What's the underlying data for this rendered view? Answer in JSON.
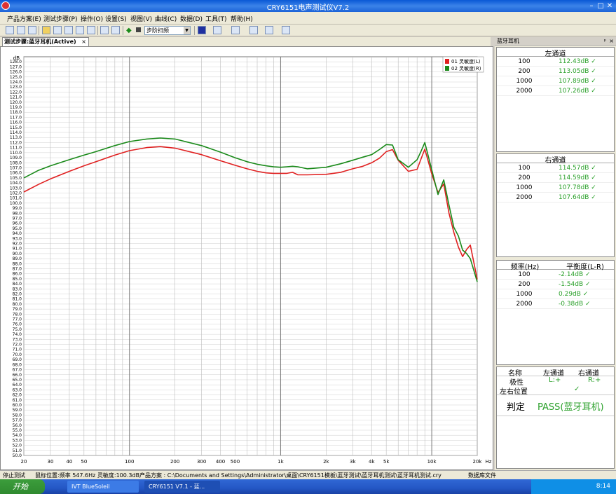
{
  "window": {
    "title": "CRY6151电声测试仪V7.2"
  },
  "menu": [
    "产品方案(E)",
    "测试步骤(P)",
    "操作(O)",
    "设置(S)",
    "视图(V)",
    "曲线(C)",
    "数据(D)",
    "工具(T)",
    "帮助(H)"
  ],
  "toolbar": {
    "sweep_mode": "步阶扫频"
  },
  "tab": {
    "label": "测试步骤:蓝牙耳机(Active)",
    "close": "×"
  },
  "panel": {
    "title": "蓝牙耳机",
    "pin": "ᵖ",
    "close": "×"
  },
  "left_channel": {
    "header": "左通道",
    "rows": [
      {
        "freq": "100",
        "value": "112.43dB ✓"
      },
      {
        "freq": "200",
        "value": "113.05dB ✓"
      },
      {
        "freq": "1000",
        "value": "107.89dB ✓"
      },
      {
        "freq": "2000",
        "value": "107.26dB ✓"
      }
    ]
  },
  "right_channel": {
    "header": "右通道",
    "rows": [
      {
        "freq": "100",
        "value": "114.57dB ✓"
      },
      {
        "freq": "200",
        "value": "114.59dB ✓"
      },
      {
        "freq": "1000",
        "value": "107.78dB ✓"
      },
      {
        "freq": "2000",
        "value": "107.64dB ✓"
      }
    ]
  },
  "balance": {
    "col1": "频率(Hz)",
    "col2": "平衡度(L-R)",
    "rows": [
      {
        "freq": "100",
        "value": "-2.14dB ✓"
      },
      {
        "freq": "200",
        "value": "-1.54dB ✓"
      },
      {
        "freq": "1000",
        "value": "0.29dB ✓"
      },
      {
        "freq": "2000",
        "value": "-0.38dB ✓"
      }
    ]
  },
  "summary": {
    "h_name": "名称",
    "h_left": "左通道",
    "h_right": "右通道",
    "polarity_label": "极性",
    "polarity_left": "L:+",
    "polarity_right": "R:+",
    "position_label": "左右位置",
    "position_value": "✓",
    "verdict_label": "判定",
    "verdict_value": "PASS(蓝牙耳机)"
  },
  "status": {
    "state": "停止测试",
    "cursor": "鼠标位置:频率 547.6Hz 灵敏度:100.3dB",
    "scheme": "产品方案 : C:\\Documents and Settings\\Administrator\\桌面\\CRY6151模板\\蓝牙测试\\蓝牙耳机测试\\蓝牙耳机测试.cry",
    "db": "数据库文件"
  },
  "taskbar": {
    "start": "开始",
    "tasks": [
      "IVT BlueSoleil",
      "CRY6151 V7.1 - 蓝..."
    ],
    "clock": "8:14"
  },
  "colors": {
    "left": "#e02020",
    "right": "#1a8a1a",
    "pass": "#2aa02a"
  },
  "chart_data": {
    "type": "line",
    "xscale": "log",
    "xlim": [
      20,
      20000
    ],
    "ylim": [
      50,
      129
    ],
    "ylabel": "dB",
    "xlabel": "Hz",
    "grid": true,
    "legend_position": "top-right",
    "x_ticks": [
      "20",
      "30",
      "40",
      "50",
      "100",
      "200",
      "300",
      "400",
      "500",
      "1k",
      "2k",
      "3k",
      "4k",
      "5k",
      "10k",
      "20k"
    ],
    "x_tick_values": [
      20,
      30,
      40,
      50,
      100,
      200,
      300,
      400,
      500,
      1000,
      2000,
      3000,
      4000,
      5000,
      10000,
      20000
    ],
    "y_ticks": [
      "50.0",
      "51.0",
      "52.0",
      "53.0",
      "54.0",
      "55.0",
      "56.0",
      "57.0",
      "58.0",
      "59.0",
      "60.0",
      "61.0",
      "62.0",
      "63.0",
      "64.0",
      "65.0",
      "66.0",
      "67.0",
      "68.0",
      "69.0",
      "70.0",
      "71.0",
      "72.0",
      "73.0",
      "74.0",
      "75.0",
      "76.0",
      "77.0",
      "78.0",
      "79.0",
      "80.0",
      "81.0",
      "82.0",
      "83.0",
      "84.0",
      "85.0",
      "86.0",
      "87.0",
      "88.0",
      "89.0",
      "90.0",
      "91.0",
      "92.0",
      "93.0",
      "94.0",
      "95.0",
      "96.0",
      "97.0",
      "98.0",
      "99.0",
      "100.0",
      "101.0",
      "102.0",
      "103.0",
      "104.0",
      "105.0",
      "106.0",
      "107.0",
      "108.0",
      "109.0",
      "110.0",
      "111.0",
      "112.0",
      "113.0",
      "114.0",
      "115.0",
      "116.0",
      "117.0",
      "118.0",
      "119.0",
      "120.0",
      "121.0",
      "122.0",
      "123.0",
      "124.0",
      "125.0",
      "126.0",
      "127.0",
      "128.0"
    ],
    "series": [
      {
        "name": "01 灵敏度(L)",
        "color": "#e02020",
        "x": [
          20,
          25,
          30,
          40,
          50,
          60,
          80,
          100,
          130,
          160,
          200,
          300,
          400,
          500,
          600,
          700,
          800,
          900,
          1000,
          1100,
          1200,
          1300,
          1500,
          2000,
          2500,
          3000,
          3500,
          4000,
          4500,
          5000,
          5500,
          6000,
          7000,
          8000,
          8500,
          9000,
          10000,
          11000,
          12000,
          13000,
          14000,
          15000,
          16000,
          17000,
          18000,
          20000
        ],
        "y": [
          102.2,
          103.7,
          104.8,
          106.3,
          107.4,
          108.2,
          109.5,
          110.4,
          111.0,
          111.2,
          110.9,
          109.6,
          108.4,
          107.5,
          106.8,
          106.3,
          106.0,
          105.9,
          105.9,
          105.9,
          106.1,
          105.6,
          105.6,
          105.7,
          106.1,
          106.8,
          107.3,
          108.0,
          108.9,
          110.2,
          110.6,
          108.5,
          106.3,
          106.7,
          108.8,
          110.7,
          105.8,
          102.1,
          103.8,
          98.0,
          94.2,
          91.3,
          89.4,
          90.8,
          91.7,
          84.9
        ]
      },
      {
        "name": "02 灵敏度(R)",
        "color": "#1a8a1a",
        "x": [
          20,
          25,
          30,
          40,
          50,
          60,
          80,
          100,
          130,
          160,
          200,
          300,
          400,
          500,
          600,
          700,
          800,
          900,
          1000,
          1100,
          1200,
          1300,
          1500,
          2000,
          2500,
          3000,
          3500,
          4000,
          4500,
          5000,
          5500,
          6000,
          7000,
          8000,
          8500,
          9000,
          10000,
          11000,
          12000,
          13000,
          14000,
          15000,
          16000,
          17000,
          18000,
          20000
        ],
        "y": [
          105.0,
          106.5,
          107.4,
          108.6,
          109.5,
          110.2,
          111.4,
          112.2,
          112.7,
          112.9,
          112.7,
          111.4,
          110.1,
          109.0,
          108.2,
          107.7,
          107.4,
          107.2,
          107.1,
          107.2,
          107.3,
          107.2,
          106.8,
          107.1,
          107.8,
          108.5,
          109.1,
          109.6,
          110.6,
          111.6,
          111.5,
          108.6,
          107.1,
          108.6,
          110.3,
          112.0,
          106.6,
          101.7,
          104.6,
          99.6,
          95.2,
          93.5,
          90.7,
          90.0,
          89.0,
          84.4
        ]
      }
    ]
  }
}
